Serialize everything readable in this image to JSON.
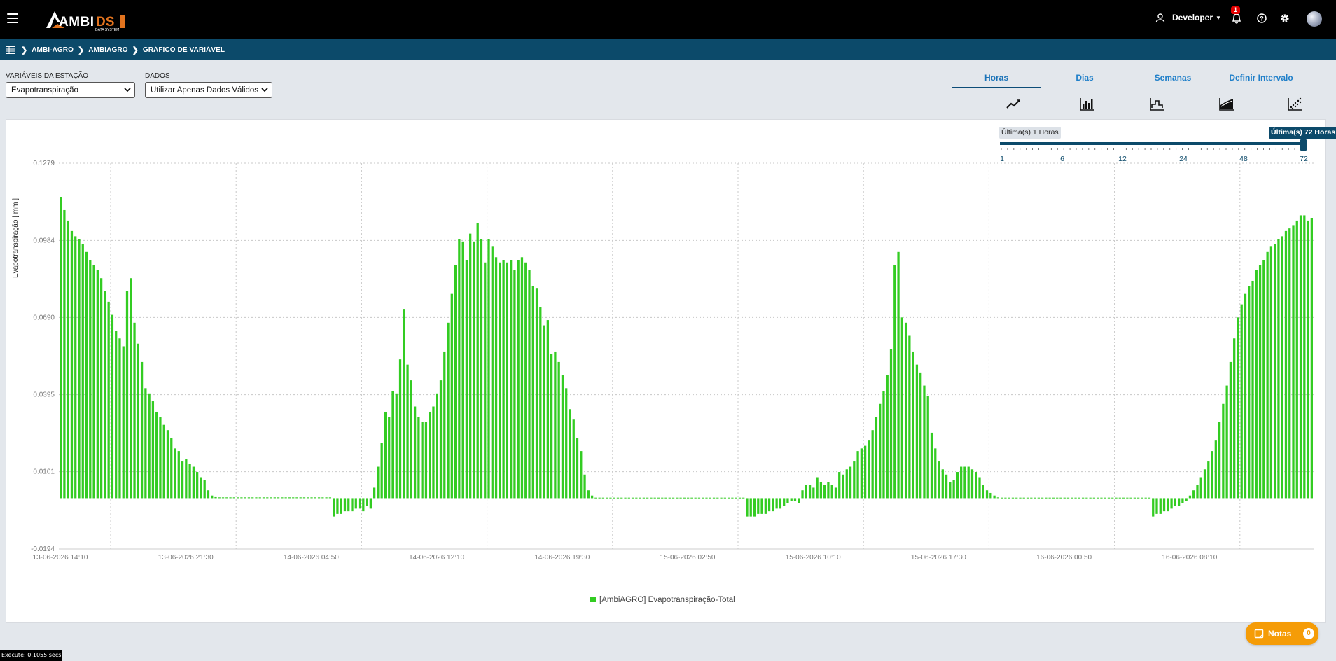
{
  "app": {
    "user_name": "Developer",
    "notification_count": "1"
  },
  "breadcrumb": [
    "AMBI-AGRO",
    "AMBIAGRO",
    "GRÁFICO DE VARIÁVEL"
  ],
  "filters": {
    "variables_label": "VARIÁVEIS DA ESTAÇÃO",
    "variables_value": "Evapotranspiração",
    "data_label": "DADOS",
    "data_value": "Utilizar Apenas Dados Válidos"
  },
  "tabs": [
    {
      "label": "Horas",
      "active": true
    },
    {
      "label": "Dias",
      "active": false
    },
    {
      "label": "Semanas",
      "active": false
    },
    {
      "label": "Definir Intervalo",
      "active": false
    }
  ],
  "chart_type_icons": [
    "line-chart-icon",
    "bar-chart-icon",
    "step-chart-icon",
    "area-chart-icon",
    "scatter-chart-icon"
  ],
  "range_slider": {
    "min_label": "Última(s) 1 Horas",
    "max_label": "Última(s) 72 Horas",
    "ticks": [
      "1",
      "6",
      "12",
      "24",
      "48",
      "72"
    ],
    "selected": 72
  },
  "notes": {
    "label": "Notas",
    "count": "0"
  },
  "status": {
    "execute": "Execute: 0.1055 secs"
  },
  "colors": {
    "bar": "#33cc22",
    "header": "#000000",
    "breadcrumb": "#0c4a6a",
    "accent": "#1f7fc9",
    "notes": "#f59c07"
  },
  "chart_data": {
    "type": "bar",
    "ylabel": "Evapotranspiração [ mm ]",
    "xlabel": "",
    "ylim": [
      -0.0194,
      0.1279
    ],
    "yticks": [
      "0.1279",
      "0.0984",
      "0.0690",
      "0.0395",
      "0.0101",
      "-0.0194"
    ],
    "xticks": [
      "13-06-2026 14:10",
      "13-06-2026 21:30",
      "14-06-2026 04:50",
      "14-06-2026 12:10",
      "14-06-2026 19:30",
      "15-06-2026 02:50",
      "15-06-2026 10:10",
      "15-06-2026 17:30",
      "16-06-2026 00:50",
      "16-06-2026 08:10"
    ],
    "series": [
      {
        "name": "[AmbiAGRO] Evapotranspiração-Total",
        "color": "#33cc22",
        "values": [
          0.115,
          0.11,
          0.106,
          0.102,
          0.1,
          0.099,
          0.097,
          0.094,
          0.091,
          0.089,
          0.087,
          0.084,
          0.079,
          0.075,
          0.07,
          0.064,
          0.061,
          0.058,
          0.079,
          0.084,
          0.067,
          0.059,
          0.052,
          0.042,
          0.04,
          0.037,
          0.033,
          0.031,
          0.028,
          0.026,
          0.023,
          0.019,
          0.018,
          0.014,
          0.015,
          0.013,
          0.012,
          0.01,
          0.008,
          0.007,
          0.003,
          0.001,
          0.0004,
          0.0003,
          0.0003,
          0.0003,
          0.0003,
          0.0003,
          0.0003,
          0.0003,
          0.0003,
          0.0003,
          0.0003,
          0.0003,
          0.0003,
          0.0003,
          0.0003,
          0.0003,
          0.0003,
          0.0003,
          0.0003,
          0.0003,
          0.0003,
          0.0003,
          0.0003,
          0.0003,
          0.0003,
          0.0003,
          0.0003,
          0.0003,
          0.0003,
          0.0003,
          0.0003,
          0.0003,
          -0.007,
          -0.006,
          -0.006,
          -0.005,
          -0.005,
          -0.005,
          -0.004,
          -0.004,
          -0.005,
          -0.003,
          -0.004,
          0.004,
          0.012,
          0.021,
          0.033,
          0.031,
          0.041,
          0.04,
          0.053,
          0.072,
          0.051,
          0.045,
          0.035,
          0.031,
          0.029,
          0.029,
          0.033,
          0.035,
          0.04,
          0.045,
          0.056,
          0.067,
          0.078,
          0.089,
          0.099,
          0.098,
          0.091,
          0.101,
          0.098,
          0.105,
          0.099,
          0.09,
          0.099,
          0.096,
          0.092,
          0.09,
          0.091,
          0.09,
          0.091,
          0.087,
          0.091,
          0.092,
          0.09,
          0.087,
          0.081,
          0.08,
          0.073,
          0.066,
          0.068,
          0.055,
          0.056,
          0.052,
          0.047,
          0.042,
          0.034,
          0.03,
          0.023,
          0.018,
          0.009,
          0.003,
          0.001,
          0.0002,
          0.0002,
          0.0002,
          0.0002,
          0.0002,
          0.0002,
          0.0002,
          0.0002,
          0.0002,
          0.0002,
          0.0002,
          0.0002,
          0.0002,
          0.0002,
          0.0002,
          0.0002,
          0.0002,
          0.0002,
          0.0002,
          0.0002,
          0.0002,
          0.0002,
          0.0002,
          0.0002,
          0.0002,
          0.0002,
          0.0002,
          0.0002,
          0.0002,
          0.0002,
          0.0002,
          0.0002,
          0.0002,
          0.0002,
          0.0002,
          0.0002,
          0.0002,
          0.0002,
          0.0002,
          0.0002,
          0.0002,
          -0.007,
          -0.007,
          -0.007,
          -0.006,
          -0.006,
          -0.006,
          -0.005,
          -0.005,
          -0.004,
          -0.004,
          -0.003,
          -0.002,
          -0.001,
          -0.001,
          -0.002,
          0.003,
          0.005,
          0.005,
          0.004,
          0.008,
          0.006,
          0.005,
          0.006,
          0.005,
          0.004,
          0.01,
          0.009,
          0.011,
          0.012,
          0.014,
          0.018,
          0.019,
          0.02,
          0.022,
          0.026,
          0.031,
          0.036,
          0.041,
          0.047,
          0.057,
          0.089,
          0.094,
          0.069,
          0.067,
          0.062,
          0.056,
          0.051,
          0.048,
          0.043,
          0.039,
          0.025,
          0.019,
          0.014,
          0.011,
          0.009,
          0.006,
          0.007,
          0.01,
          0.012,
          0.012,
          0.012,
          0.011,
          0.01,
          0.008,
          0.005,
          0.003,
          0.002,
          0.001,
          0.0003,
          0.0002,
          0.0002,
          0.0002,
          0.0002,
          0.0002,
          0.0002,
          0.0002,
          0.0002,
          0.0002,
          0.0002,
          0.0002,
          0.0002,
          0.0002,
          0.0002,
          0.0002,
          0.0002,
          0.0002,
          0.0002,
          0.0002,
          0.0002,
          0.0002,
          0.0002,
          0.0002,
          0.0002,
          0.0002,
          0.0002,
          0.0002,
          0.0002,
          0.0002,
          0.0002,
          0.0002,
          0.0002,
          0.0002,
          0.0002,
          0.0002,
          0.0002,
          0.0002,
          0.0002,
          0.0002,
          0.0002,
          0.0002,
          -0.007,
          -0.006,
          -0.006,
          -0.005,
          -0.005,
          -0.004,
          -0.003,
          -0.003,
          -0.002,
          -0.001,
          0.001,
          0.003,
          0.005,
          0.008,
          0.011,
          0.014,
          0.018,
          0.022,
          0.029,
          0.036,
          0.043,
          0.052,
          0.061,
          0.069,
          0.074,
          0.078,
          0.081,
          0.083,
          0.087,
          0.089,
          0.091,
          0.094,
          0.096,
          0.097,
          0.099,
          0.1,
          0.102,
          0.103,
          0.104,
          0.106,
          0.108,
          0.108,
          0.106,
          0.107
        ]
      }
    ],
    "legend": "bottom-center",
    "grid": true
  }
}
